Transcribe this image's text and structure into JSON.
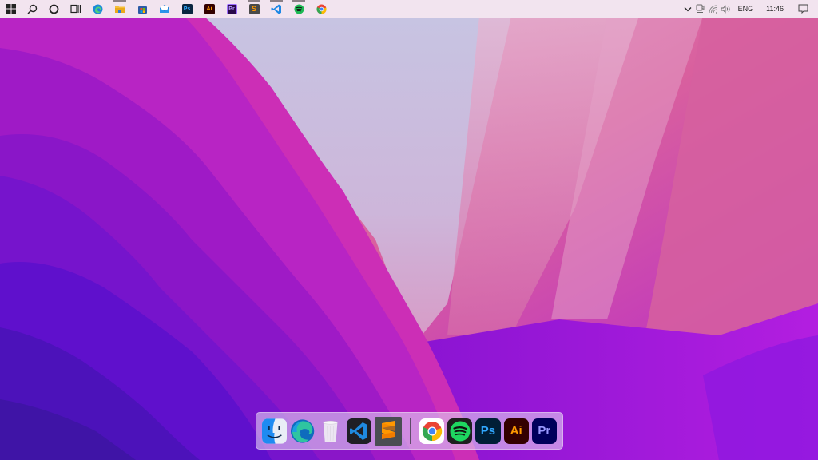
{
  "wallpaper": {
    "name": "macOS Monterey",
    "colors": {
      "deep_violet": "#4a14b8",
      "violet": "#6a12d0",
      "purple": "#9b16c8",
      "magenta": "#c92cb8",
      "pink": "#d9609e",
      "light_lilac": "#c8c2df",
      "rose": "#e2a6c8"
    }
  },
  "taskbar": {
    "background": "#f2e4ef",
    "left_buttons": [
      {
        "name": "start",
        "icon": "windows-logo-icon",
        "label": "Start"
      },
      {
        "name": "search",
        "icon": "search-icon",
        "label": "Search"
      },
      {
        "name": "cortana",
        "icon": "cortana-ring-icon",
        "label": "Cortana"
      },
      {
        "name": "task-view",
        "icon": "task-view-icon",
        "label": "Task View"
      }
    ],
    "apps": [
      {
        "name": "edge",
        "icon": "edge-icon",
        "glyph": "e",
        "color": "#1f8fe0",
        "running": false
      },
      {
        "name": "file-explorer",
        "icon": "folder-icon",
        "glyph": "",
        "color": "#f3b92d",
        "running": true
      },
      {
        "name": "microsoft-store",
        "icon": "store-icon",
        "glyph": "",
        "color": "#2d5aa8",
        "running": false
      },
      {
        "name": "mail",
        "icon": "mail-icon",
        "glyph": "",
        "color": "#1a7fd6",
        "running": false
      },
      {
        "name": "photoshop",
        "icon": "photoshop-icon",
        "glyph": "Ps",
        "color": "#0a2540",
        "fg": "#31a8ff",
        "running": false
      },
      {
        "name": "illustrator",
        "icon": "illustrator-icon",
        "glyph": "Ai",
        "color": "#330000",
        "fg": "#ff9a00",
        "running": false
      },
      {
        "name": "premiere-pro",
        "icon": "premiere-icon",
        "glyph": "Pr",
        "color": "#2a0a4a",
        "fg": "#9999ff",
        "running": false
      },
      {
        "name": "sublime-text",
        "icon": "sublime-icon",
        "glyph": "S",
        "color": "#4a4a4a",
        "fg": "#ff9800",
        "running": true
      },
      {
        "name": "vscode",
        "icon": "vscode-icon",
        "glyph": "",
        "color": "#1e88e5",
        "running": true
      },
      {
        "name": "spotify",
        "icon": "spotify-icon",
        "glyph": "",
        "color": "#1db954",
        "running": true
      },
      {
        "name": "chrome",
        "icon": "chrome-icon",
        "glyph": "",
        "color": "#ea4335",
        "running": false
      }
    ],
    "tray": {
      "overflow_icon": "chevron-up-icon",
      "meet_now_icon": "meet-now-icon",
      "network_icon": "wifi-icon",
      "volume_icon": "volume-icon",
      "language": "ENG",
      "time": "11:46",
      "notification_icon": "notification-icon"
    }
  },
  "dock": {
    "pinned": [
      {
        "name": "finder",
        "icon": "finder-icon"
      },
      {
        "name": "edge",
        "icon": "edge-icon"
      },
      {
        "name": "trash",
        "icon": "trash-icon"
      },
      {
        "name": "vscode",
        "icon": "vscode-icon"
      },
      {
        "name": "sublime-text",
        "icon": "sublime-icon",
        "active": true
      }
    ],
    "apps": [
      {
        "name": "chrome",
        "icon": "chrome-icon"
      },
      {
        "name": "spotify",
        "icon": "spotify-icon"
      },
      {
        "name": "photoshop",
        "icon": "photoshop-icon",
        "label": "Ps",
        "bg": "#001e36",
        "fg": "#31a8ff"
      },
      {
        "name": "illustrator",
        "icon": "illustrator-icon",
        "label": "Ai",
        "bg": "#330000",
        "fg": "#ff9a00"
      },
      {
        "name": "premiere-pro",
        "icon": "premiere-icon",
        "label": "Pr",
        "bg": "#00005b",
        "fg": "#9999ff"
      }
    ]
  }
}
